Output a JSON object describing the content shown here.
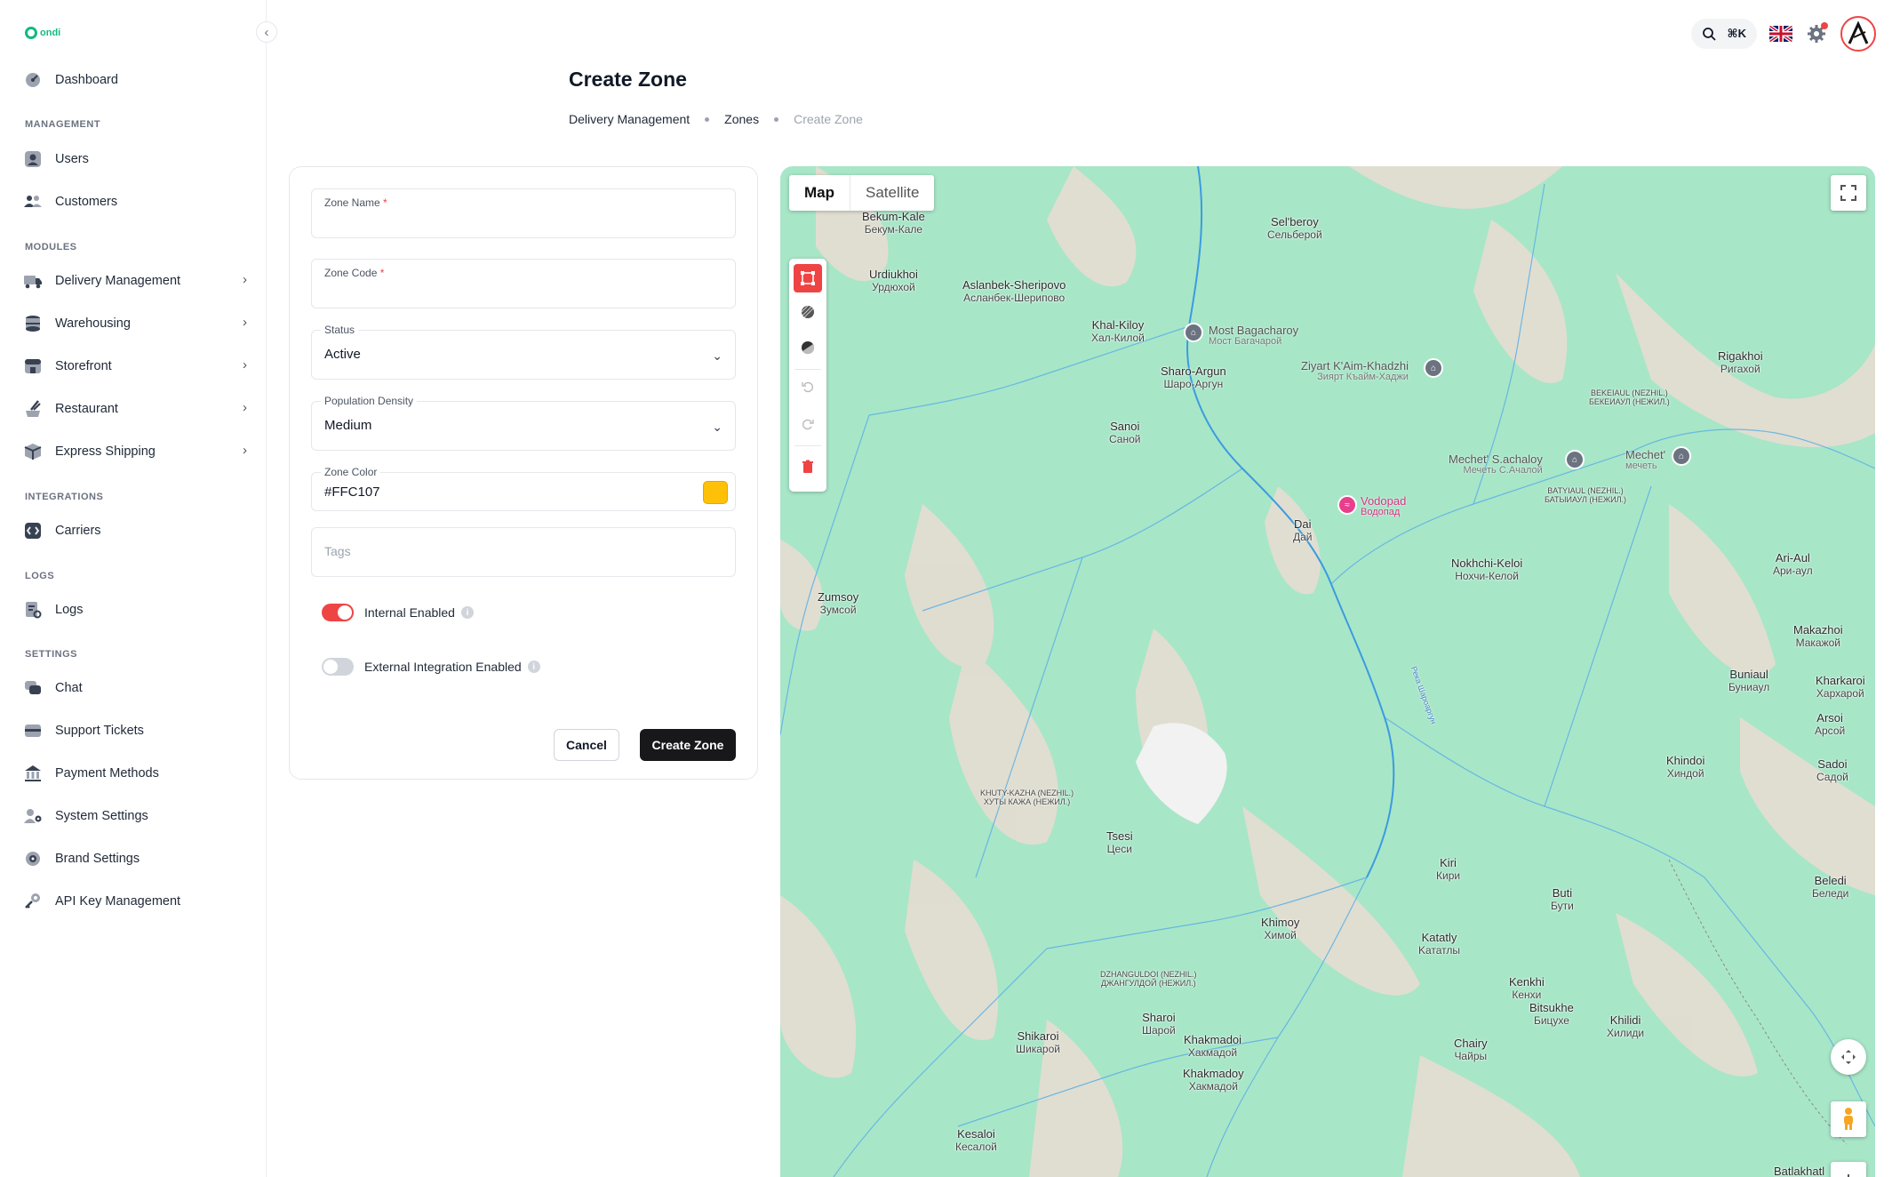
{
  "brand": {
    "logo_text": "ondi",
    "accent": "#12b981"
  },
  "sidebar": {
    "dashboard": "Dashboard",
    "sections": {
      "management": "MANAGEMENT",
      "modules": "MODULES",
      "integrations": "INTEGRATIONS",
      "logs": "LOGS",
      "settings": "SETTINGS"
    },
    "items": {
      "users": "Users",
      "customers": "Customers",
      "delivery": "Delivery Management",
      "warehousing": "Warehousing",
      "storefront": "Storefront",
      "restaurant": "Restaurant",
      "express": "Express Shipping",
      "carriers": "Carriers",
      "logs": "Logs",
      "chat": "Chat",
      "support": "Support Tickets",
      "payment": "Payment Methods",
      "system": "System Settings",
      "brand": "Brand Settings",
      "api": "API Key Management"
    }
  },
  "topbar": {
    "shortcut": "⌘K"
  },
  "page": {
    "title": "Create Zone",
    "breadcrumb": [
      "Delivery Management",
      "Zones",
      "Create Zone"
    ]
  },
  "form": {
    "zone_name_label": "Zone Name",
    "zone_code_label": "Zone Code",
    "required_mark": "*",
    "status_label": "Status",
    "status_value": "Active",
    "density_label": "Population Density",
    "density_value": "Medium",
    "color_label": "Zone Color",
    "color_value": "#FFC107",
    "tags_placeholder": "Tags",
    "internal_label": "Internal Enabled",
    "internal_enabled": true,
    "external_label": "External Integration Enabled",
    "external_enabled": false,
    "info_glyph": "i",
    "cancel_label": "Cancel",
    "submit_label": "Create Zone"
  },
  "map": {
    "tab_map": "Map",
    "tab_satellite": "Satellite",
    "places": [
      {
        "name": "Bekum-Kale",
        "sub": "Бекум-Кале"
      },
      {
        "name": "Sel'beroy",
        "sub": "Сельберой"
      },
      {
        "name": "Urdiukhoi",
        "sub": "Урдюхой"
      },
      {
        "name": "Aslanbek-Sheripovo",
        "sub": "Асланбек-Шерипово"
      },
      {
        "name": "Khal-Kiloy",
        "sub": "Хал-Килой"
      },
      {
        "name": "Sharo-Argun",
        "sub": "Шаро-Аргун"
      },
      {
        "name": "Sanoi",
        "sub": "Саной"
      },
      {
        "name": "Rigakhoi",
        "sub": "Ригахой"
      },
      {
        "name": "Dai",
        "sub": "Дай"
      },
      {
        "name": "Nokhchi-Keloi",
        "sub": "Нохчи-Келой"
      },
      {
        "name": "Ari-Aul",
        "sub": "Ари-аул"
      },
      {
        "name": "Zumsoy",
        "sub": "Зумсой"
      },
      {
        "name": "Makazhoi",
        "sub": "Макажой"
      },
      {
        "name": "Buniaul",
        "sub": "Буниаул"
      },
      {
        "name": "Kharkaroi",
        "sub": "Хархарой"
      },
      {
        "name": "Arsoi",
        "sub": "Арсой"
      },
      {
        "name": "Khindoi",
        "sub": "Хиндой"
      },
      {
        "name": "Sadoi",
        "sub": "Садой"
      },
      {
        "name": "Tsesi",
        "sub": "Цеси"
      },
      {
        "name": "Kiri",
        "sub": "Кири"
      },
      {
        "name": "Beledi",
        "sub": "Беледи"
      },
      {
        "name": "Buti",
        "sub": "Бути"
      },
      {
        "name": "Khimoy",
        "sub": "Химой"
      },
      {
        "name": "Katatly",
        "sub": "Kататлы"
      },
      {
        "name": "Kenkhi",
        "sub": "Кенхи"
      },
      {
        "name": "Bitsukhe",
        "sub": "Бицухе"
      },
      {
        "name": "Khilidi",
        "sub": "Хилиди"
      },
      {
        "name": "Sharoi",
        "sub": "Шарой"
      },
      {
        "name": "Shikaroi",
        "sub": "Шикарой"
      },
      {
        "name": "Khakmadoi",
        "sub": "Хакмадой"
      },
      {
        "name": "Khakmadoy",
        "sub": "Хакмадой"
      },
      {
        "name": "Chairy",
        "sub": "Чайры"
      },
      {
        "name": "Kesaloi",
        "sub": "Кесалой"
      },
      {
        "name": "Batlakhatl",
        "sub": ""
      }
    ],
    "small_places": [
      {
        "name": "BEKEIAUL (NEZHIL.)",
        "sub": "БЕКЕИАУЛ (НЕЖИЛ.)"
      },
      {
        "name": "BATYIAUL (NEZHIL.)",
        "sub": "БАТЫИАУЛ (НЕЖИЛ.)"
      },
      {
        "name": "KHUTY-KAZHA (NEZHIL.)",
        "sub": "ХУТЫ КАЖА (НЕЖИЛ.)"
      },
      {
        "name": "DZHANGULDOI (NEZHIL.)",
        "sub": "ДЖАНГУЛДОЙ (НЕЖИЛ.)"
      }
    ],
    "pois": [
      {
        "name": "Most Bagacharoy",
        "sub": "Мост Багачарой"
      },
      {
        "name": "Ziyart K'Aim-Khadzhi",
        "sub": "Зиярт Къайм-Хаджи"
      },
      {
        "name": "Mechet' S.achaloy",
        "sub": "Мечеть С.Ачалой"
      },
      {
        "name": "Mechet'",
        "sub": "мечеть"
      },
      {
        "name": "Vodopad",
        "sub": "Водопад"
      }
    ],
    "river": "Река Шароаргун",
    "colors": {
      "land": "#a8e6c8",
      "terrain": "#e6ddd1",
      "river": "#5ab0e6"
    }
  }
}
